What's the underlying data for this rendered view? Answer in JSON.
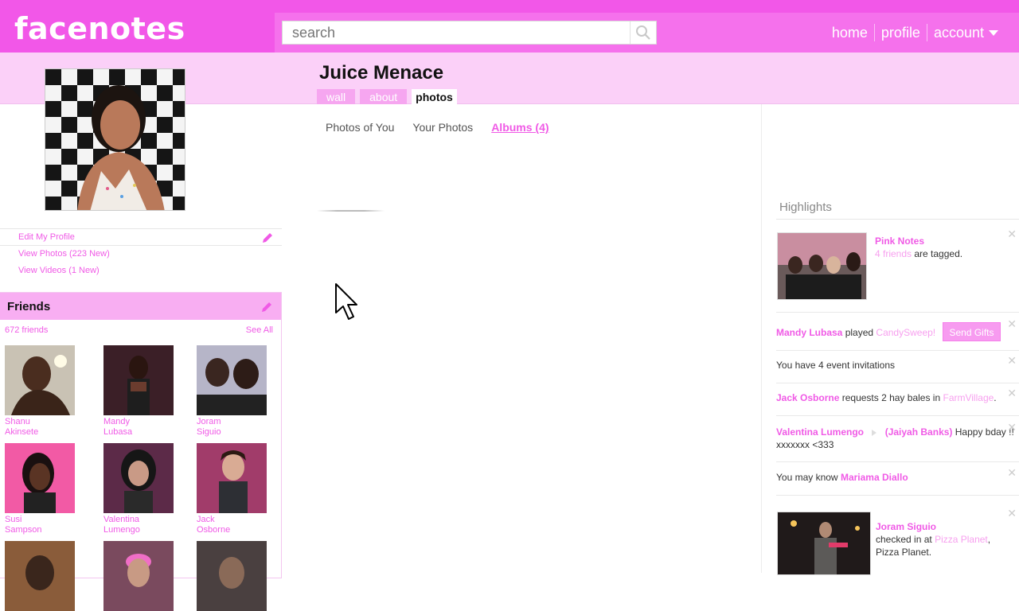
{
  "brand": "facenotes",
  "search": {
    "placeholder": "search"
  },
  "topnav": {
    "home": "home",
    "profile": "profile",
    "account": "account"
  },
  "profile": {
    "name": "Juice Menace",
    "tabs": [
      "wall",
      "about",
      "photos"
    ],
    "active_tab": "photos"
  },
  "left_links": [
    "Edit My Profile",
    "View Photos (223 New)",
    "View Videos (1 New)"
  ],
  "friends": {
    "title": "Friends",
    "count": "672 friends",
    "see_all": "See All",
    "items": [
      {
        "first": "Shanu",
        "last": "Akinsete"
      },
      {
        "first": "Mandy",
        "last": "Lubasa"
      },
      {
        "first": "Joram",
        "last": "Siguio"
      },
      {
        "first": "Susi",
        "last": "Sampson"
      },
      {
        "first": "Valentina",
        "last": "Lumengo"
      },
      {
        "first": "Jack",
        "last": "Osborne"
      }
    ]
  },
  "photo_tabs": [
    "Photos of You",
    "Your Photos",
    "Albums (4)"
  ],
  "highlights": {
    "title": "Highlights",
    "pink_notes": {
      "title": "Pink Notes",
      "friends": "4 friends",
      "rest": "are tagged."
    },
    "candy": {
      "name": "Mandy Lubasa",
      "verb": "played",
      "game": "CandySweep!",
      "button": "Send Gifts"
    },
    "events": "You have 4 event invitations",
    "farm": {
      "name": "Jack Osborne",
      "text": "requests 2 hay bales in",
      "game": "FarmVillage",
      "end": "."
    },
    "bday": {
      "from": "Valentina Lumengo",
      "to": "(Jaiyah Banks)",
      "text": "Happy bday !! xxxxxxx <333"
    },
    "may_know": {
      "text": "You may know",
      "name": "Mariama Diallo"
    },
    "checkin": {
      "name": "Joram Siguio",
      "text": "checked in at",
      "place": "Pizza Planet",
      "rest": "Pizza Planet."
    }
  },
  "colors": {
    "brand": "#f257e8",
    "bar": "#f571ec",
    "band": "#fbd0f8",
    "link": "#f05ae6"
  },
  "icons": [
    "search-icon",
    "pencil-icon",
    "close-icon",
    "chevron-down-icon",
    "cursor-icon",
    "arrow-right-icon"
  ]
}
